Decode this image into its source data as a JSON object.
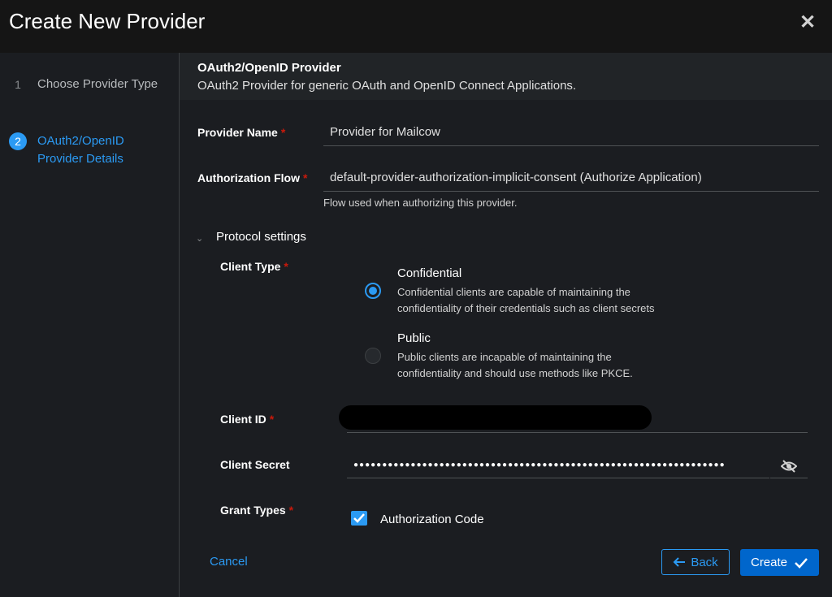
{
  "modal": {
    "title": "Create New Provider",
    "close_icon": "close-icon"
  },
  "wizard": {
    "steps": [
      {
        "number": "1",
        "label": "Choose Provider Type",
        "active": false
      },
      {
        "number": "2",
        "label": "OAuth2/OpenID Provider Details",
        "active": true
      }
    ]
  },
  "section": {
    "title": "OAuth2/OpenID Provider",
    "description": "OAuth2 Provider for generic OAuth and OpenID Connect Applications."
  },
  "form": {
    "provider_name": {
      "label": "Provider Name",
      "required": "*",
      "value": "Provider for Mailcow"
    },
    "authorization_flow": {
      "label": "Authorization Flow",
      "required": "*",
      "value": "default-provider-authorization-implicit-consent (Authorize Application)",
      "helper": "Flow used when authorizing this provider."
    },
    "protocol_settings": {
      "label": "Protocol settings",
      "expanded": true
    },
    "client_type": {
      "label": "Client Type",
      "required": "*",
      "options": [
        {
          "title": "Confidential",
          "description": "Confidential clients are capable of maintaining the confidentiality of their credentials such as client secrets",
          "checked": true
        },
        {
          "title": "Public",
          "description": "Public clients are incapable of maintaining the confidentiality and should use methods like PKCE.",
          "checked": false
        }
      ]
    },
    "client_id": {
      "label": "Client ID",
      "required": "*"
    },
    "client_secret": {
      "label": "Client Secret",
      "masked_value": "●●●●●●●●●●●●●●●●●●●●●●●●●●●●●●●●●●●●●●●●●●●●●●●●●●●●●●●●●●●●●●●●●"
    },
    "grant_types": {
      "label": "Grant Types",
      "required": "*",
      "options": [
        {
          "label": "Authorization Code",
          "checked": true
        }
      ]
    }
  },
  "footer": {
    "cancel_label": "Cancel",
    "back_label": "Back",
    "create_label": "Create"
  },
  "colors": {
    "accent": "#2b9af3",
    "primary_button": "#0066cc",
    "required": "#c9190b",
    "background": "#1b1d21",
    "header_background": "#151515"
  }
}
